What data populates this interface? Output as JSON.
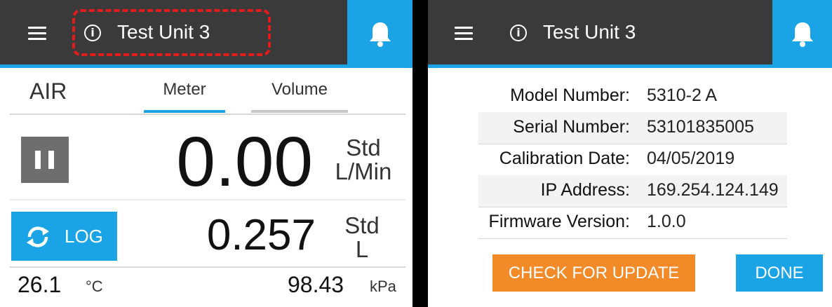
{
  "colors": {
    "header_bg": "#3a3a3a",
    "accent_blue": "#1aa4e6",
    "accent_orange": "#f28a27",
    "highlight_red": "#e31b1b",
    "pause_gray": "#6e6e6e"
  },
  "icons": {
    "menu": "hamburger-icon",
    "info": "info-icon",
    "alerts": "bell-icon",
    "pause": "pause-icon",
    "log": "sync-icon"
  },
  "left": {
    "header": {
      "info_glyph": "i",
      "title": "Test Unit 3"
    },
    "tabs": {
      "mode": "AIR",
      "meter": "Meter",
      "volume": "Volume",
      "active": "Meter"
    },
    "flow": {
      "value": "0.00",
      "unit_line1": "Std",
      "unit_line2": "L/Min"
    },
    "volume": {
      "value": "0.257",
      "unit_line1": "Std",
      "unit_line2": "L"
    },
    "log_button": {
      "label": "LOG"
    },
    "temperature": {
      "value": "26.1",
      "unit": "°C"
    },
    "pressure": {
      "value": "98.43",
      "unit": "kPa"
    }
  },
  "right": {
    "header": {
      "info_glyph": "i",
      "title": "Test Unit 3"
    },
    "rows": [
      {
        "label": "Model Number:",
        "value": "5310-2 A"
      },
      {
        "label": "Serial Number:",
        "value": "53101835005"
      },
      {
        "label": "Calibration Date:",
        "value": "04/05/2019"
      },
      {
        "label": "IP Address:",
        "value": "169.254.124.149"
      },
      {
        "label": "Firmware Version:",
        "value": "1.0.0"
      }
    ],
    "check_update_label": "CHECK FOR UPDATE",
    "done_label": "DONE"
  }
}
